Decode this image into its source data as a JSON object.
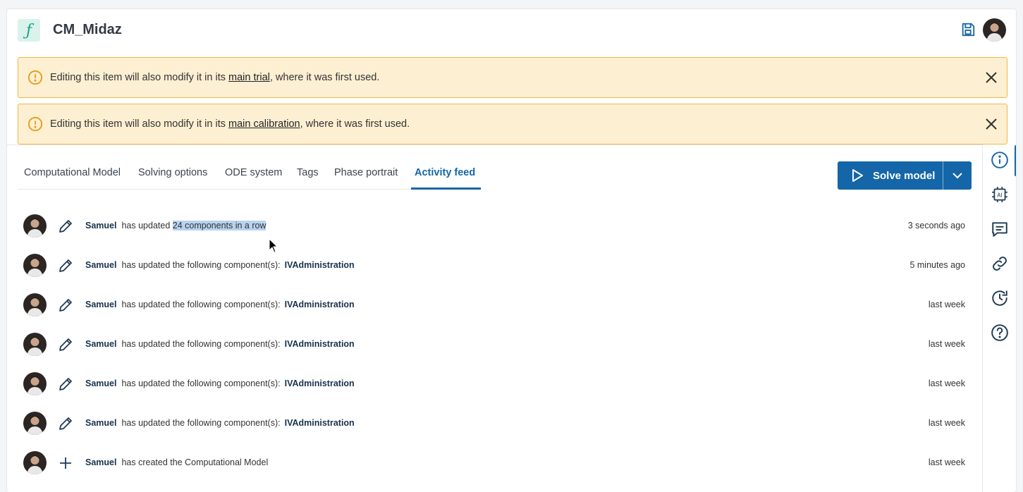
{
  "header": {
    "logo_glyph": "ƒ",
    "title": "CM_Midaz",
    "save_icon": "save-icon",
    "avatar": "user-avatar"
  },
  "alerts": [
    {
      "prefix": "Editing this item will also modify it in its ",
      "link": "main trial",
      "suffix": ", where it was first used."
    },
    {
      "prefix": "Editing this item will also modify it in its ",
      "link": "main calibration",
      "suffix": ", where it was first used."
    }
  ],
  "tabs": [
    {
      "label": "Computational Model",
      "active": false
    },
    {
      "label": "Solving options",
      "active": false
    },
    {
      "label": "ODE system",
      "active": false
    },
    {
      "label": "Tags",
      "active": false
    },
    {
      "label": "Phase portrait",
      "active": false
    },
    {
      "label": "Activity feed",
      "active": true
    }
  ],
  "solve_button": {
    "label": "Solve model"
  },
  "rail_icons": [
    "info-icon",
    "ai-chip-icon",
    "comment-icon",
    "link-icon",
    "history-icon",
    "help-icon"
  ],
  "feed": [
    {
      "user": "Samuel",
      "action": "has updated",
      "highlight": "24 components in a row",
      "component": "",
      "time": "3 seconds ago",
      "icon": "pencil-icon"
    },
    {
      "user": "Samuel",
      "action": "has updated the following component(s):",
      "highlight": "",
      "component": "IVAdministration",
      "time": "5 minutes ago",
      "icon": "pencil-icon"
    },
    {
      "user": "Samuel",
      "action": "has updated the following component(s):",
      "highlight": "",
      "component": "IVAdministration",
      "time": "last week",
      "icon": "pencil-icon"
    },
    {
      "user": "Samuel",
      "action": "has updated the following component(s):",
      "highlight": "",
      "component": "IVAdministration",
      "time": "last week",
      "icon": "pencil-icon"
    },
    {
      "user": "Samuel",
      "action": "has updated the following component(s):",
      "highlight": "",
      "component": "IVAdministration",
      "time": "last week",
      "icon": "pencil-icon"
    },
    {
      "user": "Samuel",
      "action": "has updated the following component(s):",
      "highlight": "",
      "component": "IVAdministration",
      "time": "last week",
      "icon": "pencil-icon"
    },
    {
      "user": "Samuel",
      "action": "has created the Computational Model",
      "highlight": "",
      "component": "",
      "time": "last week",
      "icon": "plus-icon"
    }
  ],
  "colors": {
    "accent": "#1466a8",
    "alert_bg": "#fdefd2",
    "alert_border": "#f2b746",
    "logo_bg": "#d9f2ec"
  }
}
